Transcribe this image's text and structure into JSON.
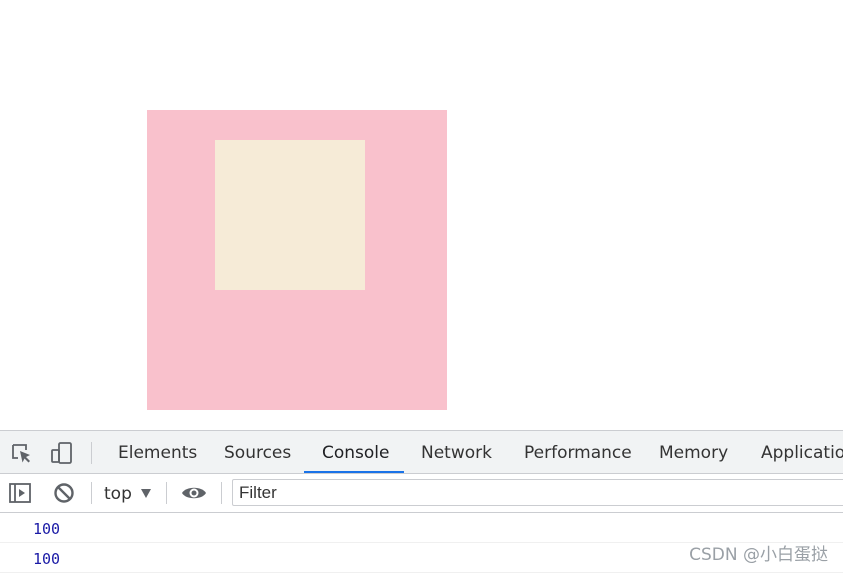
{
  "colors": {
    "outer_box": "#f9c1cc",
    "inner_box": "#f6ebd7",
    "active_tab_underline": "#1a73e8",
    "log_number": "#1a1aa6"
  },
  "devtools": {
    "tabs": [
      {
        "label": "Elements"
      },
      {
        "label": "Sources"
      },
      {
        "label": "Console"
      },
      {
        "label": "Network"
      },
      {
        "label": "Performance"
      },
      {
        "label": "Memory"
      },
      {
        "label": "Application"
      }
    ],
    "active_tab": "Console",
    "icons": {
      "inspect": "inspect-element-icon",
      "device": "device-toolbar-icon",
      "sidebar": "show-sidebar-icon",
      "clear": "clear-console-icon",
      "eye": "live-expression-eye-icon"
    },
    "context": "top",
    "filter_placeholder": "Filter"
  },
  "console": {
    "logs": [
      "100",
      "100"
    ]
  },
  "watermark": "CSDN @小白蛋挞"
}
